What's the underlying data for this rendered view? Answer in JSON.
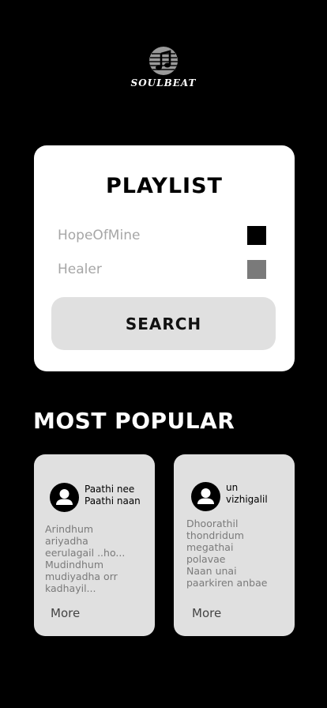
{
  "brand": {
    "name": "SOULBEAT",
    "icon": "music-note-icon"
  },
  "playlist": {
    "title": "PLAYLIST",
    "items": [
      {
        "label": "HopeOfMine",
        "check_color": "#000000"
      },
      {
        "label": "Healer",
        "check_color": "#7a7a7a"
      }
    ],
    "search_label": "SEARCH"
  },
  "popular": {
    "title": "MOST POPULAR",
    "cards": [
      {
        "song": "Paathi nee\nPaathi naan",
        "description": "Arindhum\nariyadha\neerulagail ..ho...\nMudindhum\nmudiyadha orr\nkadhayil...",
        "more_label": "More"
      },
      {
        "song": "un\nvizhigalil",
        "description": "Dhoorathil\nthondridum\nmegathai\npolavae\nNaan unai\npaarkiren anbae",
        "more_label": "More"
      }
    ]
  }
}
